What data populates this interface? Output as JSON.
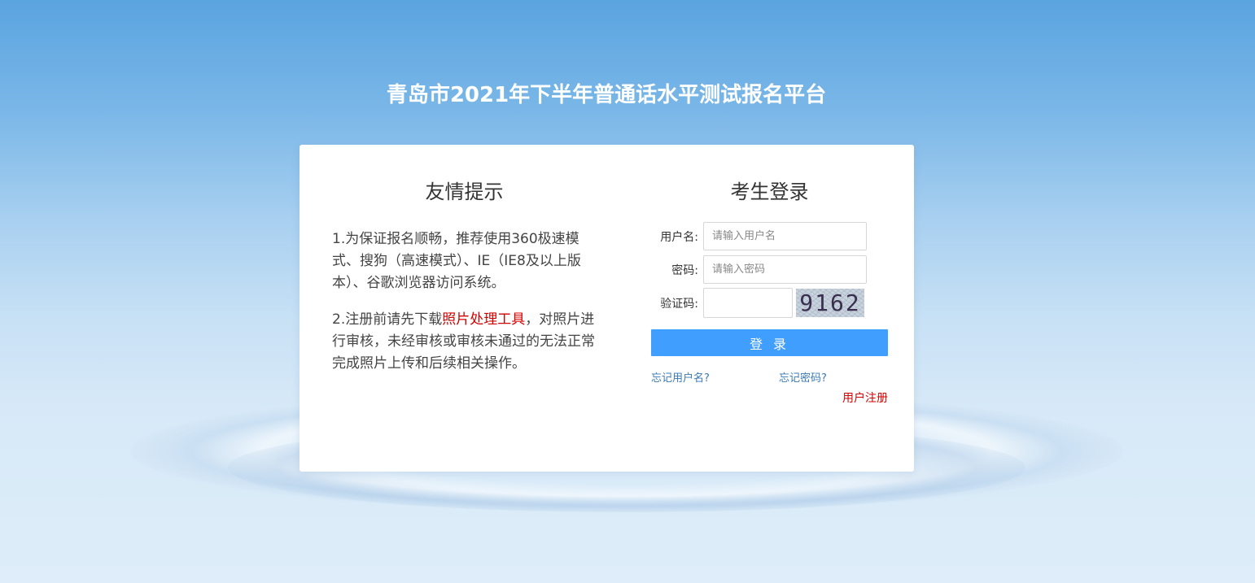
{
  "site": {
    "title": "青岛市2021年下半年普通话水平测试报名平台"
  },
  "tips": {
    "title": "友情提示",
    "item1": "1.为保证报名顺畅，推荐使用360极速模式、搜狗（高速模式）、IE（IE8及以上版本）、谷歌浏览器访问系统。",
    "item2_before": "2.注册前请先下载",
    "item2_link": "照片处理工具",
    "item2_after": "，对照片进行审核，未经审核或审核未通过的无法正常完成照片上传和后续相关操作。"
  },
  "login": {
    "title": "考生登录",
    "username_label": "用户名:",
    "username_placeholder": "请输入用户名",
    "password_label": "密码:",
    "password_placeholder": "请输入密码",
    "captcha_label": "验证码:",
    "captcha_value": "",
    "captcha_text": "9162",
    "submit_label": "登 录",
    "forgot_username": "忘记用户名?",
    "forgot_password": "忘记密码?",
    "register": "用户注册"
  },
  "colors": {
    "accent": "#409eff",
    "link": "#3a7ab5",
    "highlight": "#d40000"
  }
}
